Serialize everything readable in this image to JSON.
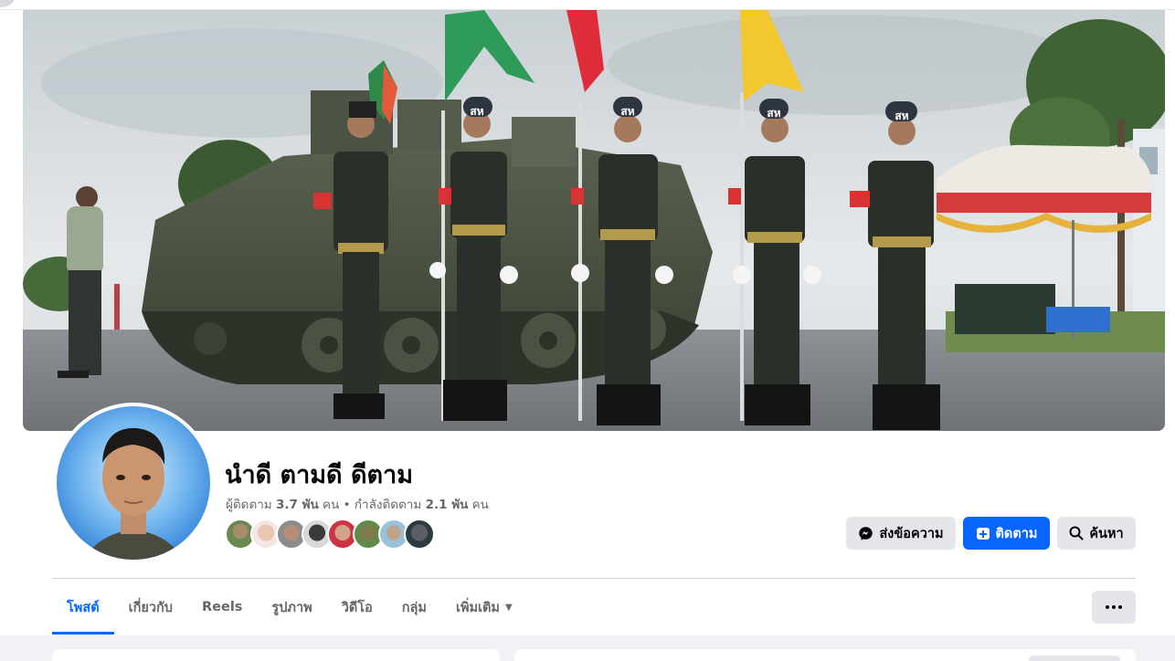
{
  "profile": {
    "name": "นำดี ตามดี ดีตาม",
    "followers_label": "ผู้ติดตาม",
    "followers_count": "3.7 พัน",
    "following_label": "กำลังติดตาม",
    "following_count": "2.1 พัน",
    "unit": "คน",
    "separator": "•"
  },
  "actions": {
    "message_label": "ส่งข้อความ",
    "follow_label": "ติดตาม",
    "search_label": "ค้นหา"
  },
  "tabs": [
    {
      "label": "โพสต์",
      "active": true
    },
    {
      "label": "เกี่ยวกับ",
      "active": false
    },
    {
      "label": "Reels",
      "active": false
    },
    {
      "label": "รูปภาพ",
      "active": false
    },
    {
      "label": "วิดีโอ",
      "active": false
    },
    {
      "label": "กลุ่ม",
      "active": false
    },
    {
      "label": "เพิ่มเติม",
      "active": false
    }
  ],
  "cover_image": {
    "helmet_text": "สห"
  },
  "icons": {
    "message": "messenger-icon",
    "follow": "follow-plus-icon",
    "search": "search-icon",
    "more": "more-dots-icon",
    "dropdown": "caret-down-icon"
  },
  "colors": {
    "accent": "#0866ff",
    "secondary_button": "#e4e6eb",
    "page_background": "#f0f2f5",
    "muted_text": "#65676b"
  }
}
